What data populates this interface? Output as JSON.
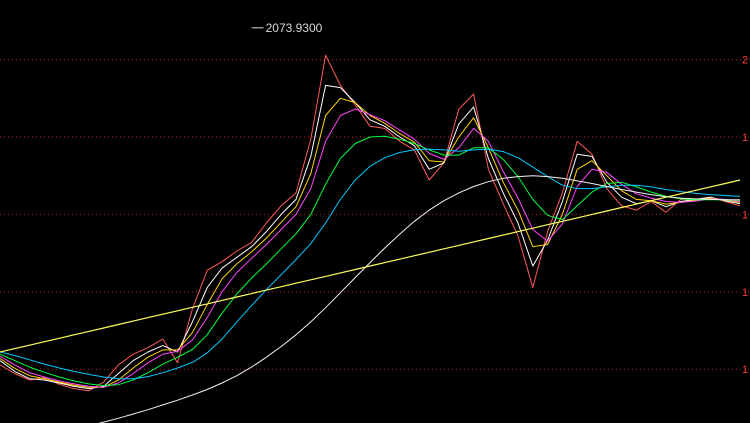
{
  "chart_data": {
    "type": "line",
    "title": "",
    "xlabel": "",
    "ylabel": "",
    "x": [
      0,
      2,
      4,
      6,
      8,
      10,
      12,
      14,
      16,
      18,
      20,
      22,
      24,
      26,
      28,
      30,
      32,
      34,
      36,
      38,
      40,
      42,
      44,
      46,
      48,
      50,
      52,
      54,
      56,
      58,
      60,
      62,
      64,
      66,
      68,
      70,
      72,
      74,
      76,
      78,
      80,
      82,
      84,
      86,
      88,
      90,
      92,
      94,
      96,
      98,
      100
    ],
    "ylim": [
      1155,
      2120
    ],
    "grid": true,
    "grid_style": "dotted",
    "y_ticks": [
      {
        "value": 2000,
        "label": "2"
      },
      {
        "value": 1820,
        "label": "1"
      },
      {
        "value": 1640,
        "label": "1"
      },
      {
        "value": 1460,
        "label": "1"
      },
      {
        "value": 1280,
        "label": "1"
      }
    ],
    "peak_annotation": {
      "x": 34,
      "value": 2073.93,
      "label": "2073.9300"
    },
    "series": [
      {
        "color": "#ff5a5a",
        "values": [
          1290,
          1270,
          1255,
          1260,
          1245,
          1235,
          1230,
          1250,
          1290,
          1315,
          1330,
          1350,
          1295,
          1420,
          1510,
          1530,
          1555,
          1575,
          1620,
          1660,
          1690,
          1815,
          2010,
          1940,
          1895,
          1845,
          1840,
          1810,
          1790,
          1720,
          1760,
          1885,
          1920,
          1745,
          1665,
          1590,
          1470,
          1600,
          1690,
          1810,
          1780,
          1700,
          1660,
          1650,
          1670,
          1645,
          1675,
          1675,
          1680,
          1670,
          1660
        ]
      },
      {
        "color": "#ffffff",
        "values": [
          1300,
          1275,
          1258,
          1255,
          1248,
          1240,
          1235,
          1240,
          1270,
          1300,
          1320,
          1335,
          1320,
          1390,
          1470,
          1515,
          1540,
          1565,
          1600,
          1640,
          1675,
          1775,
          1940,
          1935,
          1900,
          1860,
          1845,
          1820,
          1800,
          1745,
          1760,
          1850,
          1890,
          1770,
          1690,
          1620,
          1520,
          1580,
          1670,
          1780,
          1775,
          1715,
          1680,
          1665,
          1672,
          1658,
          1670,
          1675,
          1680,
          1672,
          1665
        ]
      },
      {
        "color": "#ffd400",
        "values": [
          1305,
          1282,
          1265,
          1258,
          1250,
          1243,
          1238,
          1238,
          1255,
          1283,
          1308,
          1325,
          1325,
          1365,
          1430,
          1490,
          1525,
          1553,
          1585,
          1622,
          1658,
          1735,
          1870,
          1910,
          1900,
          1870,
          1852,
          1828,
          1808,
          1765,
          1762,
          1820,
          1865,
          1795,
          1715,
          1650,
          1565,
          1570,
          1640,
          1745,
          1765,
          1730,
          1695,
          1675,
          1672,
          1664,
          1668,
          1673,
          1678,
          1674,
          1668
        ]
      },
      {
        "color": "#ff44ff",
        "values": [
          1310,
          1290,
          1272,
          1262,
          1253,
          1246,
          1240,
          1238,
          1248,
          1270,
          1295,
          1315,
          1322,
          1348,
          1400,
          1460,
          1505,
          1538,
          1570,
          1605,
          1640,
          1700,
          1810,
          1870,
          1885,
          1872,
          1858,
          1836,
          1815,
          1782,
          1768,
          1795,
          1840,
          1810,
          1740,
          1678,
          1605,
          1578,
          1618,
          1705,
          1745,
          1738,
          1710,
          1688,
          1678,
          1670,
          1668,
          1671,
          1676,
          1675,
          1670
        ]
      },
      {
        "color": "#00ff40",
        "values": [
          1315,
          1300,
          1285,
          1273,
          1262,
          1253,
          1246,
          1242,
          1244,
          1255,
          1272,
          1292,
          1308,
          1326,
          1360,
          1410,
          1455,
          1492,
          1525,
          1560,
          1595,
          1640,
          1710,
          1770,
          1805,
          1820,
          1822,
          1815,
          1805,
          1790,
          1778,
          1778,
          1795,
          1795,
          1768,
          1728,
          1675,
          1638,
          1628,
          1660,
          1692,
          1712,
          1715,
          1704,
          1692,
          1682,
          1676,
          1674,
          1674,
          1674,
          1673
        ]
      },
      {
        "color": "#00c8ff",
        "values": [
          1320,
          1312,
          1302,
          1292,
          1283,
          1275,
          1268,
          1262,
          1258,
          1258,
          1263,
          1272,
          1283,
          1296,
          1318,
          1350,
          1390,
          1428,
          1465,
          1500,
          1535,
          1572,
          1620,
          1675,
          1720,
          1752,
          1772,
          1784,
          1790,
          1792,
          1790,
          1787,
          1790,
          1792,
          1786,
          1772,
          1750,
          1728,
          1708,
          1700,
          1700,
          1704,
          1708,
          1708,
          1704,
          1698,
          1693,
          1689,
          1686,
          1684,
          1682
        ]
      },
      {
        "color": "#f2f2f2",
        "values": [
          1108,
          1112,
          1118,
          1125,
          1132,
          1140,
          1148,
          1157,
          1166,
          1176,
          1186,
          1197,
          1208,
          1220,
          1233,
          1248,
          1265,
          1285,
          1308,
          1333,
          1360,
          1390,
          1423,
          1458,
          1493,
          1528,
          1562,
          1594,
          1624,
          1650,
          1672,
          1690,
          1705,
          1716,
          1724,
          1728,
          1730,
          1728,
          1724,
          1718,
          1712,
          1705,
          1698,
          1692,
          1686,
          1681,
          1678,
          1676,
          1675,
          1674,
          1674
        ]
      },
      {
        "color": "#ffff60",
        "values": [
          1320,
          1328,
          1336,
          1344,
          1352,
          1360,
          1368,
          1376,
          1384,
          1392,
          1400,
          1408,
          1416,
          1424,
          1432,
          1440,
          1448,
          1456,
          1464,
          1472,
          1480,
          1488,
          1496,
          1504,
          1512,
          1520,
          1528,
          1536,
          1544,
          1552,
          1560,
          1568,
          1576,
          1584,
          1592,
          1600,
          1608,
          1616,
          1624,
          1632,
          1640,
          1648,
          1656,
          1664,
          1672,
          1680,
          1688,
          1696,
          1704,
          1712,
          1720
        ]
      }
    ]
  }
}
